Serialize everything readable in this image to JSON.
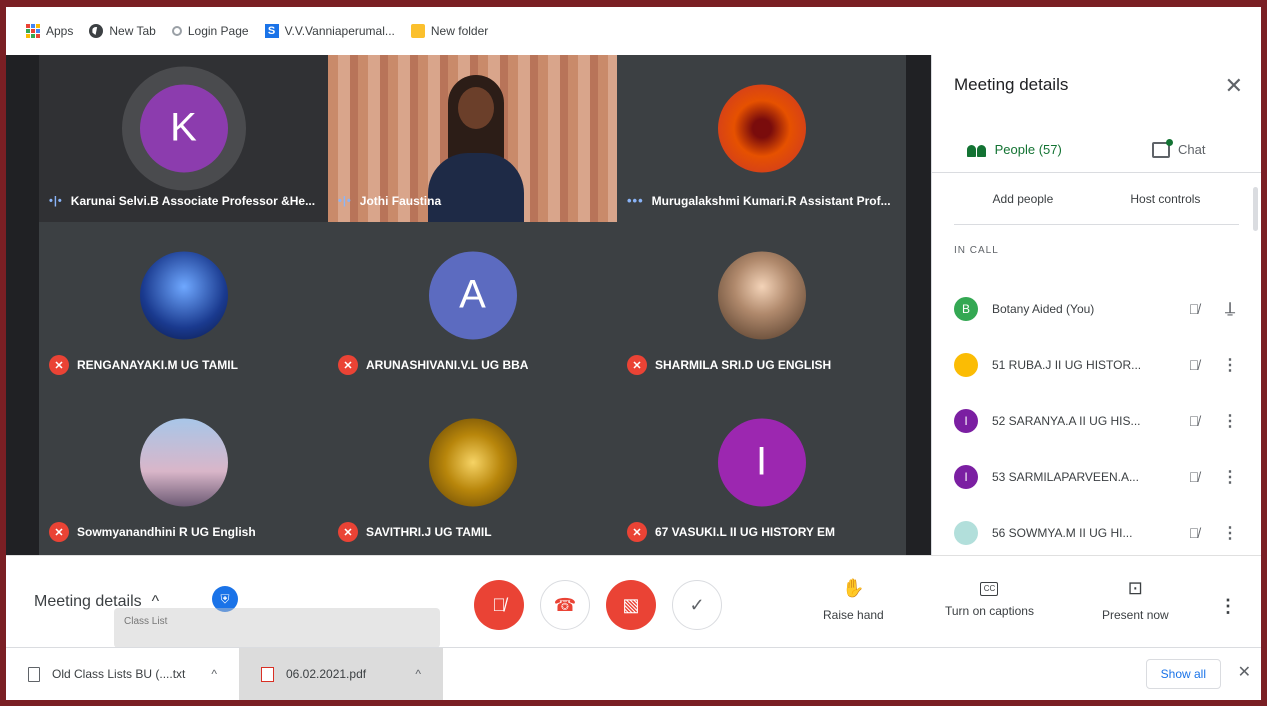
{
  "bookmarks": [
    {
      "label": "Apps",
      "icon": "apps-grid-icon"
    },
    {
      "label": "New Tab",
      "icon": "globe-icon"
    },
    {
      "label": "Login Page",
      "icon": "page-icon"
    },
    {
      "label": "V.V.Vanniaperumal...",
      "icon": "s-logo-icon"
    },
    {
      "label": "New folder",
      "icon": "folder-icon"
    }
  ],
  "tiles": [
    {
      "name": "Karunai Selvi.B Associate Professor &He...",
      "initial": "K",
      "status": "speaking",
      "avatar_color": "#7b1fa2"
    },
    {
      "name": "Jothi Faustina",
      "initial": "",
      "status": "speaking",
      "avatar_color": ""
    },
    {
      "name": "Murugalakshmi Kumari.R Assistant Prof...",
      "initial": "",
      "status": "more",
      "avatar_color": "#d84315"
    },
    {
      "name": "RENGANAYAKI.M UG TAMIL",
      "initial": "",
      "status": "muted",
      "avatar_color": "#1a3a8f"
    },
    {
      "name": "ARUNASHIVANI.V.L UG BBA",
      "initial": "A",
      "status": "muted",
      "avatar_color": "#5c6bc0"
    },
    {
      "name": "SHARMILA SRI.D UG ENGLISH",
      "initial": "",
      "status": "muted",
      "avatar_color": "#b0896c"
    },
    {
      "name": "Sowmyanandhini R UG English",
      "initial": "",
      "status": "muted",
      "avatar_color": "#8fb2d8"
    },
    {
      "name": "SAVITHRI.J UG TAMIL",
      "initial": "",
      "status": "muted",
      "avatar_color": "#8a6d1f"
    },
    {
      "name": "67 VASUKI.L II UG HISTORY EM",
      "initial": "I",
      "status": "muted",
      "avatar_color": "#9c27b0"
    }
  ],
  "sidebar": {
    "title": "Meeting details",
    "tabs": [
      {
        "label": "People (57)",
        "active": true
      },
      {
        "label": "Chat",
        "active": false
      }
    ],
    "add_people": "Add people",
    "host_controls": "Host controls",
    "section_label": "IN CALL",
    "participants": [
      {
        "name": "Botany Aided (You)",
        "initial": "B",
        "color": "#34a853",
        "action": "pin"
      },
      {
        "name": "51 RUBA.J II UG HISTOR...",
        "initial": "",
        "color": "#fbbc04",
        "action": "more"
      },
      {
        "name": "52 SARANYA.A II UG HIS...",
        "initial": "I",
        "color": "#7b1fa2",
        "action": "more"
      },
      {
        "name": "53 SARMILAPARVEEN.A...",
        "initial": "I",
        "color": "#7b1fa2",
        "action": "more"
      },
      {
        "name": "56 SOWMYA.M II UG HI...",
        "initial": "",
        "color": "#b2dfdb",
        "action": "more"
      }
    ]
  },
  "controls": {
    "meeting_details": "Meeting details",
    "ghost_text": "Class List",
    "raise_hand": "Raise hand",
    "captions": "Turn on captions",
    "present": "Present now"
  },
  "downloads": {
    "items": [
      "Old Class Lists BU (....txt",
      "06.02.2021.pdf"
    ],
    "show_all": "Show all"
  }
}
